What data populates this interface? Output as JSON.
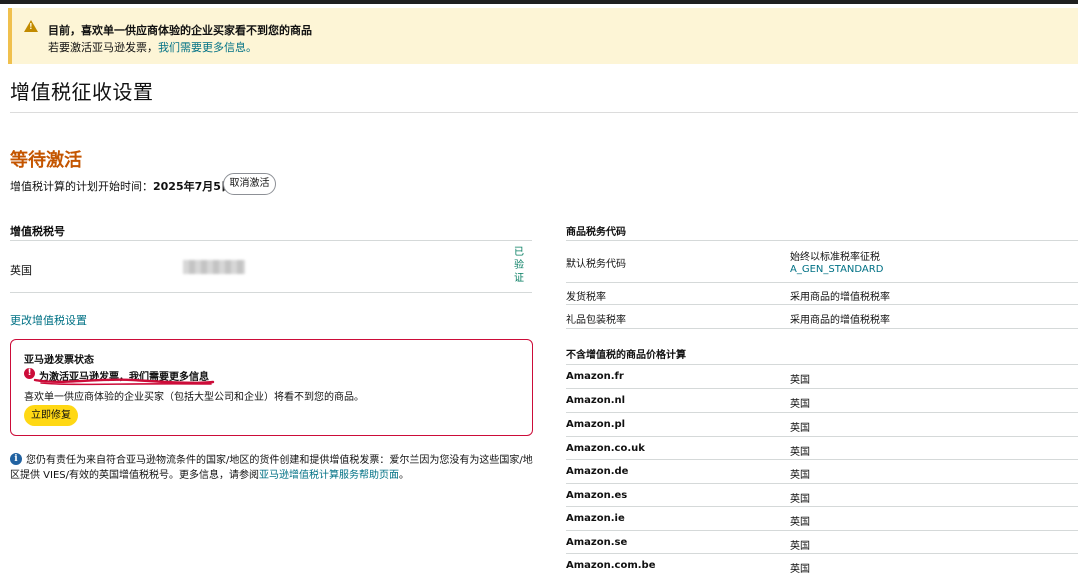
{
  "banner": {
    "line1": "目前，喜欢单一供应商体验的企业买家看不到您的商品",
    "line2_prefix": "若要激活亚马逊发票，",
    "line2_link": "我们需要更多信息。"
  },
  "page_title": "增值税征收设置",
  "status": {
    "title": "等待激活",
    "schedule_label": "增值税计算的计划开始时间：",
    "schedule_date": "2025年7月5日.",
    "cancel_label": "取消激活"
  },
  "vat_table": {
    "header": "增值税税号",
    "country": "英国",
    "verified": "已验证",
    "change_link": "更改增值税设置"
  },
  "invoice": {
    "title": "亚马逊发票状态",
    "message": "为激活亚马逊发票，我们需要更多信息",
    "desc": "喜欢单一供应商体验的企业买家（包括大型公司和企业）将看不到您的商品。",
    "fix_label": "立即修复"
  },
  "info": {
    "text": "您仍有责任为来自符合亚马逊物流条件的国家/地区的货件创建和提供增值税发票：爱尔兰因为您没有为这些国家/地区提供 VIES/有效的英国增值税税号。更多信息，请参阅",
    "link": "亚马逊增值税计算服务帮助页面",
    "suffix": "。"
  },
  "tax_codes": {
    "header": "商品税务代码",
    "default_label": "默认税务代码",
    "default_value": "始终以标准税率征税",
    "default_code": "A_GEN_STANDARD",
    "shipping_label": "发货税率",
    "shipping_value": "采用商品的增值税税率",
    "gift_label": "礼品包装税率",
    "gift_value": "采用商品的增值税税率"
  },
  "markets": {
    "header": "不含增值税的商品价格计算",
    "rows": [
      {
        "market": "Amazon.fr",
        "country": "英国"
      },
      {
        "market": "Amazon.nl",
        "country": "英国"
      },
      {
        "market": "Amazon.pl",
        "country": "英国"
      },
      {
        "market": "Amazon.co.uk",
        "country": "英国"
      },
      {
        "market": "Amazon.de",
        "country": "英国"
      },
      {
        "market": "Amazon.es",
        "country": "英国"
      },
      {
        "market": "Amazon.ie",
        "country": "英国"
      },
      {
        "market": "Amazon.se",
        "country": "英国"
      },
      {
        "market": "Amazon.com.be",
        "country": "英国"
      }
    ]
  },
  "colors": {
    "accent_orange": "#c45500",
    "link_teal": "#007185",
    "error_red": "#cc0c39",
    "button_yellow": "#ffd814",
    "banner_bg": "#fdf5d6"
  }
}
